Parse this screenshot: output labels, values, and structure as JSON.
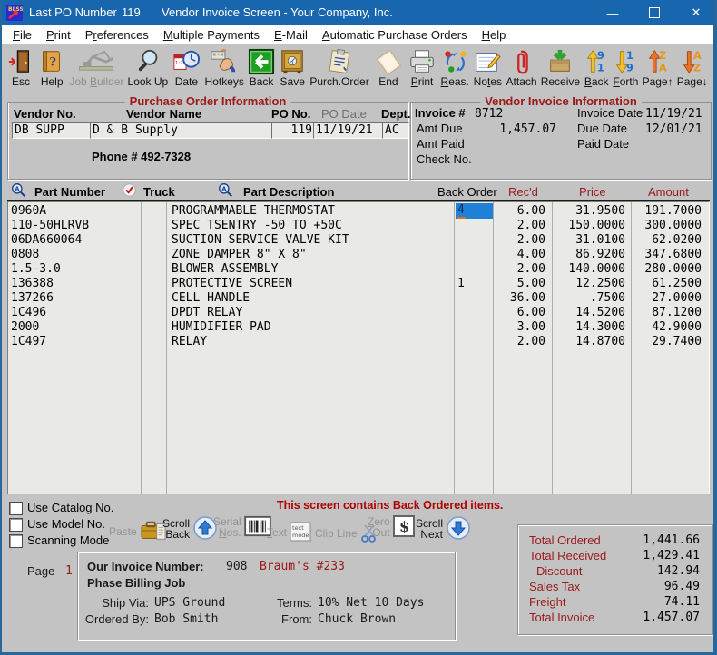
{
  "window": {
    "pre_title_label": "Last PO Number",
    "pre_title_value": "119",
    "title": "Vendor Invoice Screen - Your Company, Inc.",
    "minimize": "—",
    "maximize": "▢",
    "close": "✕"
  },
  "menu": {
    "items": [
      {
        "label": "<u>F</u>ile"
      },
      {
        "label": "<u>P</u>rint"
      },
      {
        "label": "P<u>r</u>eferences"
      },
      {
        "label": "<u>M</u>ultiple Payments"
      },
      {
        "label": "<u>E</u>-Mail"
      },
      {
        "label": "<u>A</u>utomatic Purchase Orders"
      },
      {
        "label": "<u>H</u>elp"
      }
    ]
  },
  "toolbar": {
    "items": [
      {
        "label": "Esc"
      },
      {
        "label": "Help"
      },
      {
        "label": "Job <u>B</u>uilder"
      },
      {
        "label": "Look Up"
      },
      {
        "label": "Date"
      },
      {
        "label": "Hotkeys"
      },
      {
        "label": "Back"
      },
      {
        "label": "Save"
      },
      {
        "label": "Purch.Order"
      },
      {
        "label": "End"
      },
      {
        "label": "<u>P</u>rint"
      },
      {
        "label": "<u>R</u>eas."
      },
      {
        "label": "No<u>t</u>es"
      },
      {
        "label": "Attach"
      },
      {
        "label": "Receive"
      },
      {
        "label": "<u>B</u>ack"
      },
      {
        "label": "<u>F</u>orth"
      },
      {
        "label": "Page↑"
      },
      {
        "label": "Page↓"
      }
    ]
  },
  "po_info": {
    "title": "Purchase Order Information",
    "vendor_no_label": "Vendor No.",
    "vendor_name_label": "Vendor Name",
    "po_no_label": "PO No.",
    "po_date_label": "PO Date",
    "dept_label": "Dept.",
    "vendor_no": "DB SUPP",
    "vendor_name": "D & B Supply",
    "po_no": "119",
    "po_date": "11/19/21",
    "dept": "AC",
    "phone": "Phone # 492-7328"
  },
  "invoice_info": {
    "title": "Vendor Invoice Information",
    "invoice_label": "Invoice #",
    "invoice_no": "8712",
    "invoice_date_label": "Invoice Date",
    "invoice_date": "11/19/21",
    "amt_due_label": "Amt Due",
    "amt_due": "1,457.07",
    "due_date_label": "Due Date",
    "due_date": "12/01/21",
    "amt_paid_label": "Amt Paid",
    "paid_date_label": "Paid Date",
    "check_no_label": "Check No."
  },
  "grid": {
    "headers": {
      "part": "Part Number",
      "truck": "Truck",
      "desc": "Part Description",
      "back": "Back Order",
      "recd": "Rec'd",
      "price": "Price",
      "amount": "Amount"
    },
    "rows": [
      {
        "part": "0960A",
        "desc": "PROGRAMMABLE THERMOSTAT",
        "back": "4",
        "recd": "6.00",
        "price": "31.9500",
        "amount": "191.7000"
      },
      {
        "part": "110-50HLRVB",
        "desc": "SPEC TSENTRY -50 TO +50C",
        "back": "",
        "recd": "2.00",
        "price": "150.0000",
        "amount": "300.0000"
      },
      {
        "part": "06DA660064",
        "desc": "SUCTION SERVICE VALVE KIT",
        "back": "",
        "recd": "2.00",
        "price": "31.0100",
        "amount": "62.0200"
      },
      {
        "part": "0808",
        "desc": "ZONE DAMPER 8\" X 8\"",
        "back": "",
        "recd": "4.00",
        "price": "86.9200",
        "amount": "347.6800"
      },
      {
        "part": "1.5-3.0",
        "desc": "BLOWER ASSEMBLY",
        "back": "",
        "recd": "2.00",
        "price": "140.0000",
        "amount": "280.0000"
      },
      {
        "part": "136388",
        "desc": "PROTECTIVE SCREEN",
        "back": "1",
        "recd": "5.00",
        "price": "12.2500",
        "amount": "61.2500"
      },
      {
        "part": "137266",
        "desc": "CELL HANDLE",
        "back": "",
        "recd": "36.00",
        "price": ".7500",
        "amount": "27.0000"
      },
      {
        "part": "1C496",
        "desc": "DPDT RELAY",
        "back": "",
        "recd": "6.00",
        "price": "14.5200",
        "amount": "87.1200"
      },
      {
        "part": "2000",
        "desc": "HUMIDIFIER PAD",
        "back": "",
        "recd": "3.00",
        "price": "14.3000",
        "amount": "42.9000"
      },
      {
        "part": "1C497",
        "desc": "RELAY",
        "back": "",
        "recd": "2.00",
        "price": "14.8700",
        "amount": "29.7400"
      }
    ]
  },
  "options": {
    "use_catalog": "Use Catalog No.",
    "use_model": "Use Model No.",
    "scanning": "Scanning Mode",
    "message": "This screen contains Back Ordered items."
  },
  "actions": {
    "paste": "Paste",
    "scroll_back": "Scroll<br>Back",
    "serial_nos": "Serial<br><u>N</u>os.",
    "text": "<u>T</u>ext",
    "clip_line": "Clip Line",
    "zero_out": "<u>Z</u>ero<br>Out",
    "scroll_next": "Scroll<br>Next"
  },
  "footer": {
    "page_label": "Page",
    "page_value": "1",
    "our_invoice_label": "Our Invoice Number:",
    "our_invoice_no": "908",
    "our_invoice_note": "Braum's #233",
    "phase_label": "Phase Billing Job",
    "ship_via_label": "Ship Via:",
    "ship_via": "UPS Ground",
    "terms_label": "Terms:",
    "terms": "10% Net 10 Days",
    "ordered_by_label": "Ordered By:",
    "ordered_by": "Bob Smith",
    "from_label": "From:",
    "from": "Chuck Brown"
  },
  "totals": {
    "rows": [
      {
        "label": "Total Ordered",
        "value": "1,441.66"
      },
      {
        "label": "Total Received",
        "value": "1,429.41"
      },
      {
        "label": "- Discount",
        "value": "142.94"
      },
      {
        "label": "Sales Tax",
        "value": "96.49"
      },
      {
        "label": "Freight",
        "value": "74.11"
      },
      {
        "label": "Total Invoice",
        "value": "1,457.07"
      }
    ]
  },
  "colors": {
    "titlebar": "#1866ae",
    "section_title_red": "#9b1a1a",
    "message_red": "#b00000",
    "selection_blue": "#1e80d6",
    "window_gray": "#c3c3c3"
  }
}
